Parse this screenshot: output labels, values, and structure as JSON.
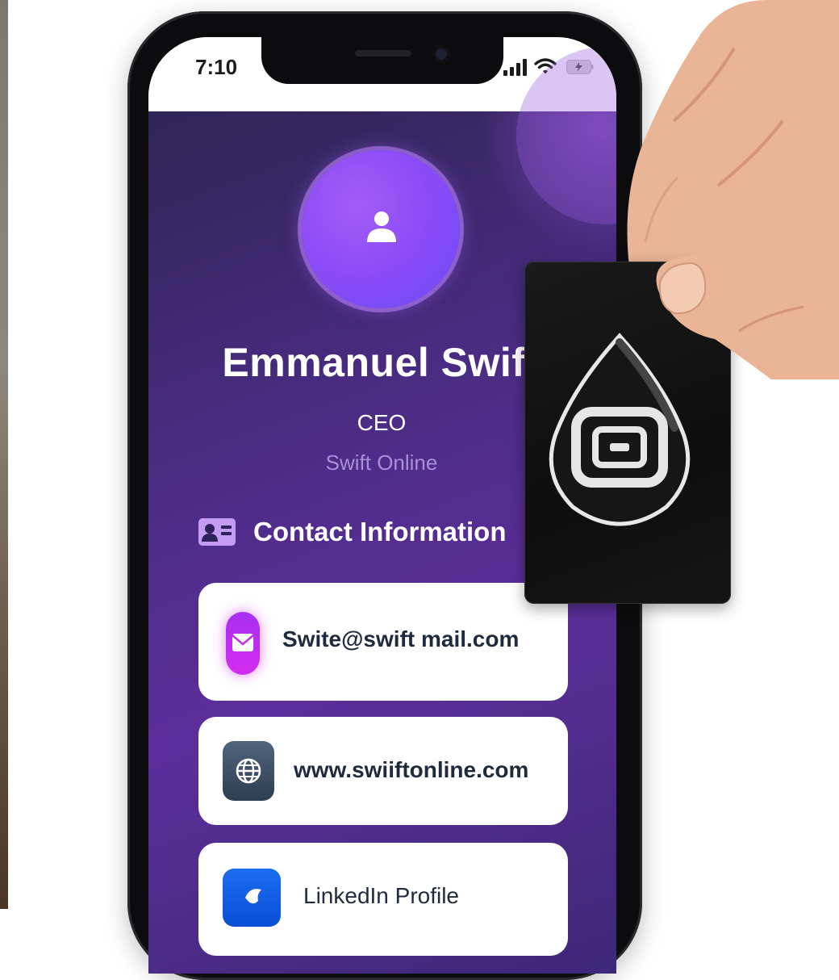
{
  "status_bar": {
    "time": "7:10",
    "icons": [
      "signal-icon",
      "wifi-icon",
      "battery-icon"
    ]
  },
  "profile": {
    "name": "Emmanuel Swift",
    "title": "CEO",
    "company": "Swift Online",
    "avatar_icon": "person-icon"
  },
  "contact": {
    "section_title": "Contact Information",
    "section_icon": "contact-card-icon",
    "items": [
      {
        "icon": "email-icon",
        "label": "Swite@swift mail.com"
      },
      {
        "icon": "globe-icon",
        "label": "www.swiiftonline.com"
      },
      {
        "icon": "linkedin-icon",
        "label": "LinkedIn Profile"
      }
    ]
  },
  "colors": {
    "background_gradient": [
      "#2f2556",
      "#5c2e9a"
    ],
    "avatar": "#8a4bf7",
    "email_icon": "#c42df0",
    "web_icon": "#3d4f66",
    "linkedin_icon": "#1360e6",
    "card_text": "#1f2a3d",
    "company_text": "#a890d6"
  },
  "nfc_card": {
    "logo_icon": "nfc-drop-logo-icon"
  }
}
